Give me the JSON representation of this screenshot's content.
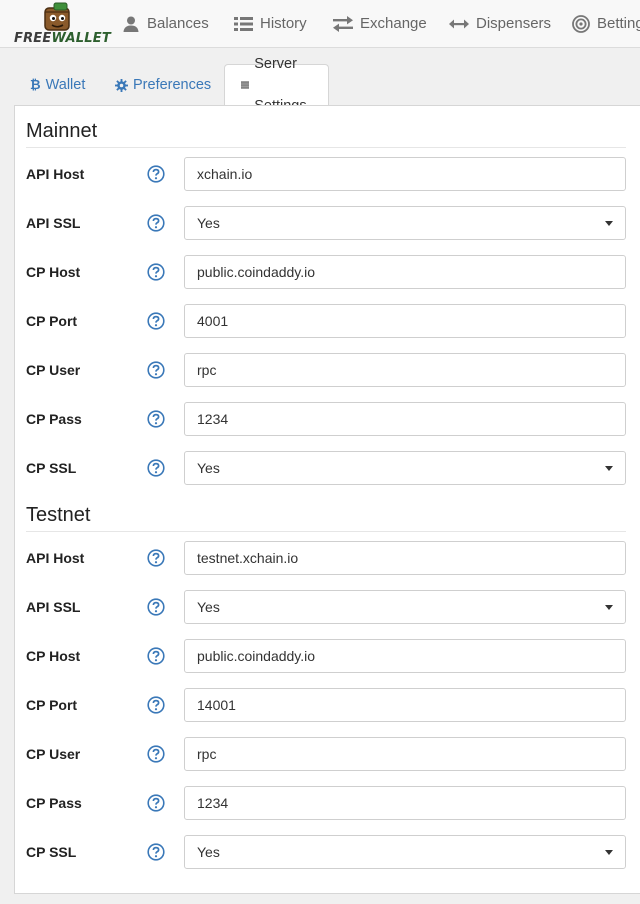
{
  "app": {
    "logo_text_free": "FREE",
    "logo_text_wallet": "WALLET"
  },
  "nav": {
    "items": [
      {
        "label": "Balances",
        "icon": "user-icon"
      },
      {
        "label": "History",
        "icon": "list-icon"
      },
      {
        "label": "Exchange",
        "icon": "exchange-arrows-icon"
      },
      {
        "label": "Dispensers",
        "icon": "left-right-arrow-icon"
      },
      {
        "label": "Betting",
        "icon": "target-icon"
      }
    ]
  },
  "tabs": [
    {
      "label": "Wallet",
      "icon": "bitcoin-icon",
      "active": false
    },
    {
      "label": "Preferences",
      "icon": "gear-icon",
      "active": false
    },
    {
      "label": "Server Settings",
      "icon": "server-list-icon",
      "active": true
    }
  ],
  "colors": {
    "link": "#3a78b8",
    "logo_green": "#2d5f2e",
    "help_blue": "#3a78b8"
  },
  "mainnet": {
    "title": "Mainnet",
    "fields": [
      {
        "label": "API Host",
        "type": "text",
        "value": "xchain.io"
      },
      {
        "label": "API SSL",
        "type": "select",
        "value": "Yes"
      },
      {
        "label": "CP Host",
        "type": "text",
        "value": "public.coindaddy.io"
      },
      {
        "label": "CP Port",
        "type": "text",
        "value": "4001"
      },
      {
        "label": "CP User",
        "type": "text",
        "value": "rpc"
      },
      {
        "label": "CP Pass",
        "type": "text",
        "value": "1234"
      },
      {
        "label": "CP SSL",
        "type": "select",
        "value": "Yes"
      }
    ]
  },
  "testnet": {
    "title": "Testnet",
    "fields": [
      {
        "label": "API Host",
        "type": "text",
        "value": "testnet.xchain.io"
      },
      {
        "label": "API SSL",
        "type": "select",
        "value": "Yes"
      },
      {
        "label": "CP Host",
        "type": "text",
        "value": "public.coindaddy.io"
      },
      {
        "label": "CP Port",
        "type": "text",
        "value": "14001"
      },
      {
        "label": "CP User",
        "type": "text",
        "value": "rpc"
      },
      {
        "label": "CP Pass",
        "type": "text",
        "value": "1234"
      },
      {
        "label": "CP SSL",
        "type": "select",
        "value": "Yes"
      }
    ]
  }
}
